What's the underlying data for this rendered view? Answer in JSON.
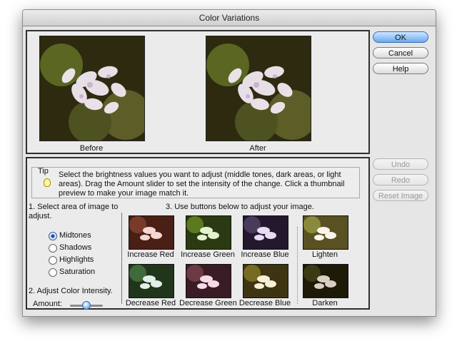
{
  "window": {
    "title": "Color Variations"
  },
  "preview": {
    "before_label": "Before",
    "after_label": "After"
  },
  "buttons": {
    "ok": "OK",
    "cancel": "Cancel",
    "help": "Help",
    "undo": "Undo",
    "redo": "Redo",
    "reset": "Reset Image"
  },
  "tip": {
    "label": "Tip",
    "text": "Select the brightness values you want to adjust (middle tones, dark areas, or light areas). Drag the Amount slider to set the intensity of the change. Click a thumbnail preview to make your image match it."
  },
  "step1": {
    "label": "1. Select area of image to adjust.",
    "options": [
      "Midtones",
      "Shadows",
      "Highlights",
      "Saturation"
    ],
    "selected": "Midtones"
  },
  "step2": {
    "label": "2. Adjust Color Intensity.",
    "amount_label": "Amount:",
    "amount_fraction": 0.5
  },
  "step3": {
    "label": "3. Use buttons below to adjust your image.",
    "thumbs_top": [
      "Increase Red",
      "Increase Green",
      "Increase Blue",
      "Lighten"
    ],
    "thumbs_bottom": [
      "Decrease Red",
      "Decrease Green",
      "Decrease Blue",
      "Darken"
    ]
  },
  "colors": {
    "accent": "#6aa9ef",
    "frame": "#2f2f2f",
    "photo_dark": "#2d2a10",
    "photo_green": "#5f6d24",
    "blossom": "#f2e9f3"
  }
}
